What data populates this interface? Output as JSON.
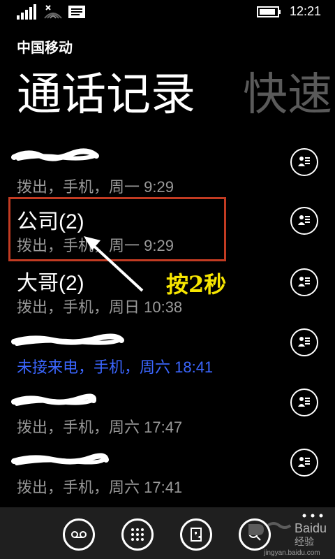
{
  "status_bar": {
    "time": "12:21",
    "icons": [
      "signal-icon",
      "wifi-icon",
      "message-icon",
      "battery-icon"
    ]
  },
  "header": {
    "carrier": "中国移动",
    "pivot_title": "通话记录",
    "pivot_next": "快速"
  },
  "calls": [
    {
      "name": "",
      "meta": "拨出，手机，周一 9:29",
      "missed": false,
      "redacted": true
    },
    {
      "name": "公司(2)",
      "meta": "拨出，手机，周一 9:29",
      "missed": false,
      "redacted": false
    },
    {
      "name": "大哥(2)",
      "meta": "拨出，手机，周日 10:38",
      "missed": false,
      "redacted": false
    },
    {
      "name": "",
      "meta": "未接来电，手机，周六 18:41",
      "missed": true,
      "redacted": true
    },
    {
      "name": "",
      "meta": "拨出，手机，周六 17:47",
      "missed": false,
      "redacted": true
    },
    {
      "name": "",
      "meta": "拨出，手机，周六 17:41",
      "missed": false,
      "redacted": true
    }
  ],
  "annotation": {
    "text": "按2秒",
    "color": "#f7e600",
    "box_color": "#c23b22"
  },
  "app_bar": {
    "buttons": [
      "voicemail-icon",
      "keypad-icon",
      "phonebook-icon",
      "search-icon"
    ],
    "more": "more-icon"
  },
  "watermark": {
    "brand": "Baidu经验",
    "url": "jingyan.baidu.com"
  },
  "colors": {
    "background": "#000000",
    "primary_text": "#ffffff",
    "secondary_text": "#9a9a9a",
    "missed_call": "#3b66ff",
    "appbar": "#1f1f1f"
  }
}
